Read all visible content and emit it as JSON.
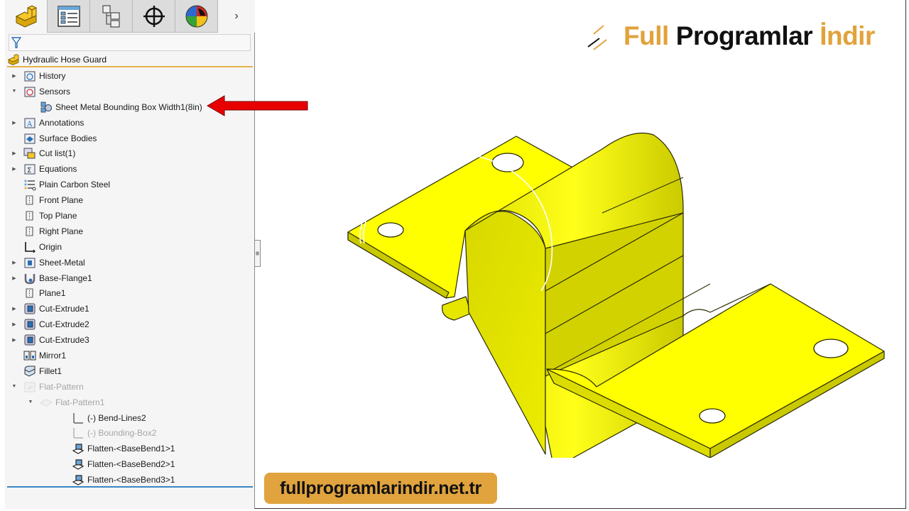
{
  "panel": {
    "tabs": [
      {
        "name": "feature-manager",
        "icon": "part-icon",
        "active": true
      },
      {
        "name": "property-manager",
        "icon": "property-list-icon",
        "active": false
      },
      {
        "name": "configuration-manager",
        "icon": "configuration-tree-icon",
        "active": false
      },
      {
        "name": "dimxpert-manager",
        "icon": "crosshair-icon",
        "active": false
      },
      {
        "name": "display-manager",
        "icon": "appearance-sphere-icon",
        "active": false
      }
    ],
    "more_label": "›",
    "filter_icon": "funnel-icon",
    "root": {
      "label": "Hydraulic Hose Guard",
      "icon": "part-icon"
    },
    "tree": [
      {
        "label": "History",
        "icon": "history-folder-icon",
        "caret": "collapsed",
        "indent": 0,
        "dim": false
      },
      {
        "label": "Sensors",
        "icon": "sensors-folder-icon",
        "caret": "expanded",
        "indent": 0,
        "dim": false
      },
      {
        "label": "Sheet Metal Bounding Box Width1(8in)",
        "icon": "sensor-icon",
        "caret": "none",
        "indent": 1,
        "dim": false
      },
      {
        "label": "Annotations",
        "icon": "annotations-folder-icon",
        "caret": "collapsed",
        "indent": 0,
        "dim": false
      },
      {
        "label": "Surface Bodies",
        "icon": "surface-bodies-folder-icon",
        "caret": "none",
        "indent": 0,
        "dim": false
      },
      {
        "label": "Cut list(1)",
        "icon": "cut-list-icon",
        "caret": "collapsed",
        "indent": 0,
        "dim": false
      },
      {
        "label": "Equations",
        "icon": "equations-folder-icon",
        "caret": "collapsed",
        "indent": 0,
        "dim": false
      },
      {
        "label": "Plain Carbon Steel",
        "icon": "material-icon",
        "caret": "none",
        "indent": 0,
        "dim": false
      },
      {
        "label": "Front Plane",
        "icon": "plane-icon",
        "caret": "none",
        "indent": 0,
        "dim": false
      },
      {
        "label": "Top Plane",
        "icon": "plane-icon",
        "caret": "none",
        "indent": 0,
        "dim": false
      },
      {
        "label": "Right Plane",
        "icon": "plane-icon",
        "caret": "none",
        "indent": 0,
        "dim": false
      },
      {
        "label": "Origin",
        "icon": "origin-icon",
        "caret": "none",
        "indent": 0,
        "dim": false
      },
      {
        "label": "Sheet-Metal",
        "icon": "sheet-metal-icon",
        "caret": "collapsed",
        "indent": 0,
        "dim": false
      },
      {
        "label": "Base-Flange1",
        "icon": "base-flange-icon",
        "caret": "collapsed",
        "indent": 0,
        "dim": false
      },
      {
        "label": "Plane1",
        "icon": "plane-icon",
        "caret": "none",
        "indent": 0,
        "dim": false
      },
      {
        "label": "Cut-Extrude1",
        "icon": "cut-extrude-icon",
        "caret": "collapsed",
        "indent": 0,
        "dim": false
      },
      {
        "label": "Cut-Extrude2",
        "icon": "cut-extrude-icon",
        "caret": "collapsed",
        "indent": 0,
        "dim": false
      },
      {
        "label": "Cut-Extrude3",
        "icon": "cut-extrude-icon",
        "caret": "collapsed",
        "indent": 0,
        "dim": false
      },
      {
        "label": "Mirror1",
        "icon": "mirror-icon",
        "caret": "none",
        "indent": 0,
        "dim": false
      },
      {
        "label": "Fillet1",
        "icon": "fillet-icon",
        "caret": "none",
        "indent": 0,
        "dim": false
      },
      {
        "label": "Flat-Pattern",
        "icon": "flat-pattern-folder-icon",
        "caret": "expanded",
        "indent": 0,
        "dim": true
      },
      {
        "label": "Flat-Pattern1",
        "icon": "flat-pattern-icon",
        "caret": "expanded",
        "indent": 1,
        "dim": true
      },
      {
        "label": "(-) Bend-Lines2",
        "icon": "sketch-icon",
        "caret": "none",
        "indent": 2,
        "dim": false
      },
      {
        "label": "(-) Bounding-Box2",
        "icon": "sketch-icon",
        "caret": "none",
        "indent": 2,
        "dim": true
      },
      {
        "label": "Flatten-<BaseBend1>1",
        "icon": "flatten-icon",
        "caret": "none",
        "indent": 2,
        "dim": false
      },
      {
        "label": "Flatten-<BaseBend2>1",
        "icon": "flatten-icon",
        "caret": "none",
        "indent": 2,
        "dim": false
      },
      {
        "label": "Flatten-<BaseBend3>1",
        "icon": "flatten-icon",
        "caret": "none",
        "indent": 2,
        "dim": false
      }
    ]
  },
  "annotation": {
    "arrow_color": "#e80000",
    "points_to": "Sheet Metal Bounding Box Width1(8in)"
  },
  "watermark": {
    "brand_part1": "Full",
    "brand_part2": "Programlar",
    "brand_part3": "İndir",
    "url": "fullprogramlarindir.net.tr",
    "accent_color": "#e2a23b"
  },
  "viewport": {
    "model_name": "Hydraulic Hose Guard",
    "model_color": "#ffff00"
  }
}
